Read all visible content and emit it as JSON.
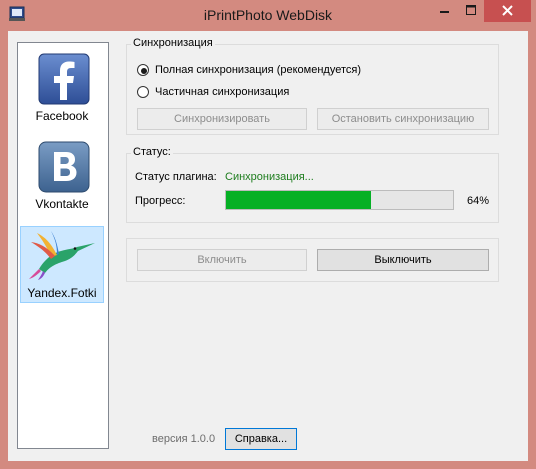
{
  "window": {
    "title": "iPrintPhoto WebDisk",
    "controls": {
      "minimize_icon": "minimize-icon",
      "maximize_icon": "maximize-icon",
      "close_icon": "close-icon"
    }
  },
  "services": [
    {
      "label": "Facebook",
      "icon": "facebook-icon"
    },
    {
      "label": "Vkontakte",
      "icon": "vkontakte-icon"
    },
    {
      "label": "Yandex.Fotki",
      "icon": "hummingbird-icon",
      "selected": true
    }
  ],
  "sync": {
    "group_title": "Синхронизация",
    "full_sync_label": "Полная синхронизация (рекомендуется)",
    "partial_sync_label": "Частичная синхронизация",
    "selected": "full",
    "sync_button": "Синхронизировать",
    "stop_button": "Остановить синхронизацию"
  },
  "status": {
    "group_title": "Статус:",
    "plugin_status_label": "Статус плагина:",
    "plugin_status_value": "Синхронизация...",
    "progress_label": "Прогресс:",
    "progress_value": 64,
    "progress_text": "64%"
  },
  "actions": {
    "enable_button": "Включить",
    "disable_button": "Выключить"
  },
  "footer": {
    "version": "версия 1.0.0",
    "help_button": "Справка..."
  },
  "colors": {
    "window_frame": "#d38a80",
    "progress_fill": "#06b025",
    "status_text": "#1e7d1e",
    "close_button": "#c75050"
  }
}
